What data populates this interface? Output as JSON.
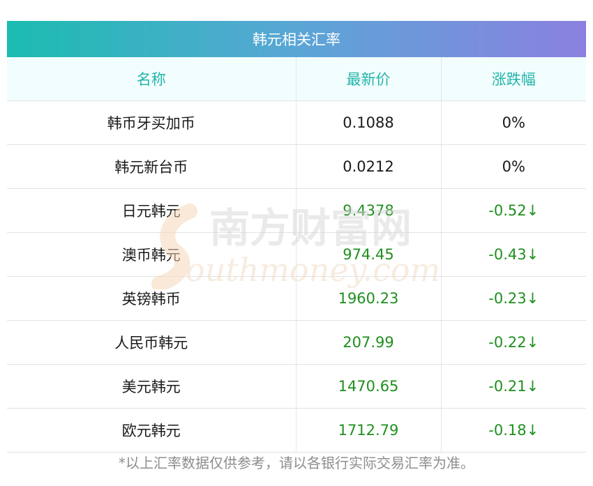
{
  "header": {
    "title": "韩元相关汇率"
  },
  "table": {
    "columns": [
      "名称",
      "最新价",
      "涨跌幅"
    ],
    "rows": [
      {
        "name": "韩币牙买加币",
        "price": "0.1088",
        "change": "0%",
        "trend": "flat"
      },
      {
        "name": "韩元新台币",
        "price": "0.0212",
        "change": "0%",
        "trend": "flat"
      },
      {
        "name": "日元韩元",
        "price": "9.4378",
        "change": "-0.52↓",
        "trend": "down"
      },
      {
        "name": "澳币韩元",
        "price": "974.45",
        "change": "-0.43↓",
        "trend": "down"
      },
      {
        "name": "英镑韩币",
        "price": "1960.23",
        "change": "-0.23↓",
        "trend": "down"
      },
      {
        "name": "人民币韩元",
        "price": "207.99",
        "change": "-0.22↓",
        "trend": "down"
      },
      {
        "name": "美元韩元",
        "price": "1470.65",
        "change": "-0.21↓",
        "trend": "down"
      },
      {
        "name": "欧元韩元",
        "price": "1712.79",
        "change": "-0.18↓",
        "trend": "down"
      }
    ]
  },
  "watermark": {
    "cn": "南方财富网",
    "en": "outhmoney.com"
  },
  "footer": {
    "note": "*以上汇率数据仅供参考，请以各银行实际交易汇率为准。"
  },
  "colors": {
    "header_start": "#1bbcb0",
    "header_end": "#8b80e0",
    "heading_text": "#23b5ab",
    "down": "#1f8f1f"
  }
}
